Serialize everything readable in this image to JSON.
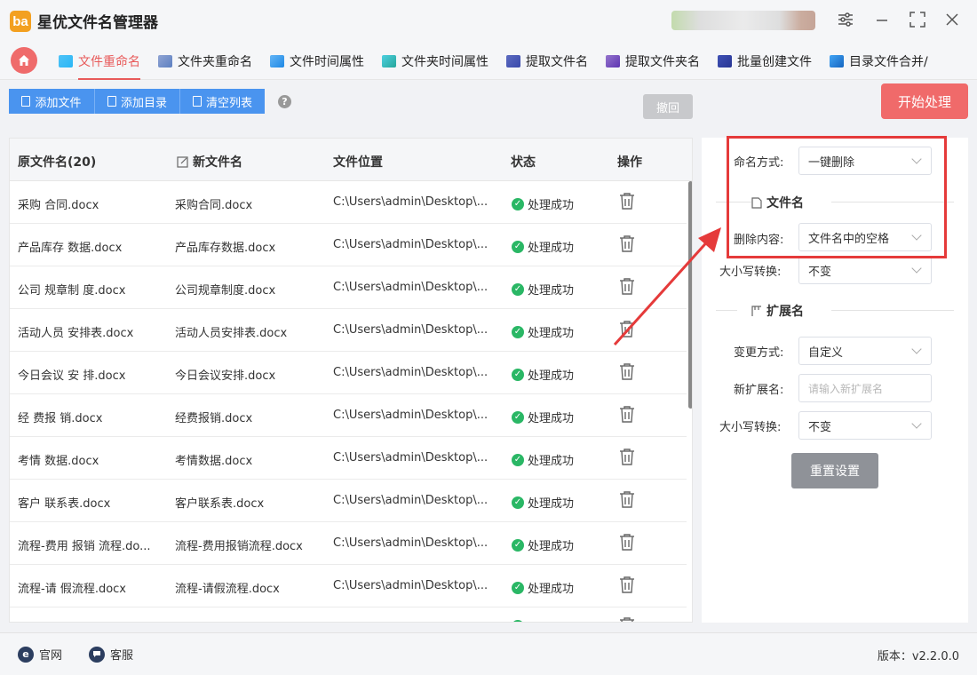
{
  "app": {
    "logo_text": "ba",
    "title": "星优文件名管理器"
  },
  "tabs": [
    {
      "label": "文件重命名",
      "active": true,
      "icon": "rename-file-icon"
    },
    {
      "label": "文件夹重命名",
      "icon": "rename-folder-icon"
    },
    {
      "label": "文件时间属性",
      "icon": "file-time-icon"
    },
    {
      "label": "文件夹时间属性",
      "icon": "folder-time-icon"
    },
    {
      "label": "提取文件名",
      "icon": "extract-filename-icon"
    },
    {
      "label": "提取文件夹名",
      "icon": "extract-foldername-icon"
    },
    {
      "label": "批量创建文件",
      "icon": "batch-create-icon"
    },
    {
      "label": "目录文件合并/",
      "icon": "merge-icon"
    }
  ],
  "toolbar": {
    "add_file": "添加文件",
    "add_dir": "添加目录",
    "clear_list": "清空列表",
    "help": "?",
    "undo": "撤回",
    "start": "开始处理"
  },
  "table": {
    "headers": {
      "original": "原文件名(20)",
      "new": "新文件名",
      "location": "文件位置",
      "status": "状态",
      "action": "操作"
    },
    "rows": [
      {
        "original": "采购 合同.docx",
        "new": "采购合同.docx",
        "location": "C:\\Users\\admin\\Desktop\\...",
        "status": "处理成功"
      },
      {
        "original": "产品库存 数据.docx",
        "new": "产品库存数据.docx",
        "location": "C:\\Users\\admin\\Desktop\\...",
        "status": "处理成功"
      },
      {
        "original": "公司 规章制 度.docx",
        "new": "公司规章制度.docx",
        "location": "C:\\Users\\admin\\Desktop\\...",
        "status": "处理成功"
      },
      {
        "original": "活动人员 安排表.docx",
        "new": "活动人员安排表.docx",
        "location": "C:\\Users\\admin\\Desktop\\...",
        "status": "处理成功"
      },
      {
        "original": "今日会议 安 排.docx",
        "new": "今日会议安排.docx",
        "location": "C:\\Users\\admin\\Desktop\\...",
        "status": "处理成功"
      },
      {
        "original": "经 费报 销.docx",
        "new": "经费报销.docx",
        "location": "C:\\Users\\admin\\Desktop\\...",
        "status": "处理成功"
      },
      {
        "original": "考情 数据.docx",
        "new": "考情数据.docx",
        "location": "C:\\Users\\admin\\Desktop\\...",
        "status": "处理成功"
      },
      {
        "original": "客户 联系表.docx",
        "new": "客户联系表.docx",
        "location": "C:\\Users\\admin\\Desktop\\...",
        "status": "处理成功"
      },
      {
        "original": "流程-费用 报销 流程.do...",
        "new": "流程-费用报销流程.docx",
        "location": "C:\\Users\\admin\\Desktop\\...",
        "status": "处理成功"
      },
      {
        "original": "流程-请 假流程.docx",
        "new": "流程-请假流程.docx",
        "location": "C:\\Users\\admin\\Desktop\\...",
        "status": "处理成功"
      }
    ]
  },
  "panel": {
    "naming_mode_label": "命名方式:",
    "naming_mode_value": "一键删除",
    "filename_section": "文件名",
    "delete_content_label": "删除内容:",
    "delete_content_value": "文件名中的空格",
    "case_label": "大小写转换:",
    "case_value": "不变",
    "ext_section": "扩展名",
    "change_mode_label": "变更方式:",
    "change_mode_value": "自定义",
    "new_ext_label": "新扩展名:",
    "new_ext_placeholder": "请输入新扩展名",
    "ext_case_label": "大小写转换:",
    "ext_case_value": "不变",
    "reset": "重置设置"
  },
  "footer": {
    "website": "官网",
    "website_icon": "e",
    "support": "客服",
    "version": "版本：v2.2.0.0"
  },
  "colors": {
    "accent_red": "#f06a6a",
    "primary_blue": "#4a94ef",
    "success_green": "#2ab765",
    "highlight_red": "#e53a3a"
  }
}
